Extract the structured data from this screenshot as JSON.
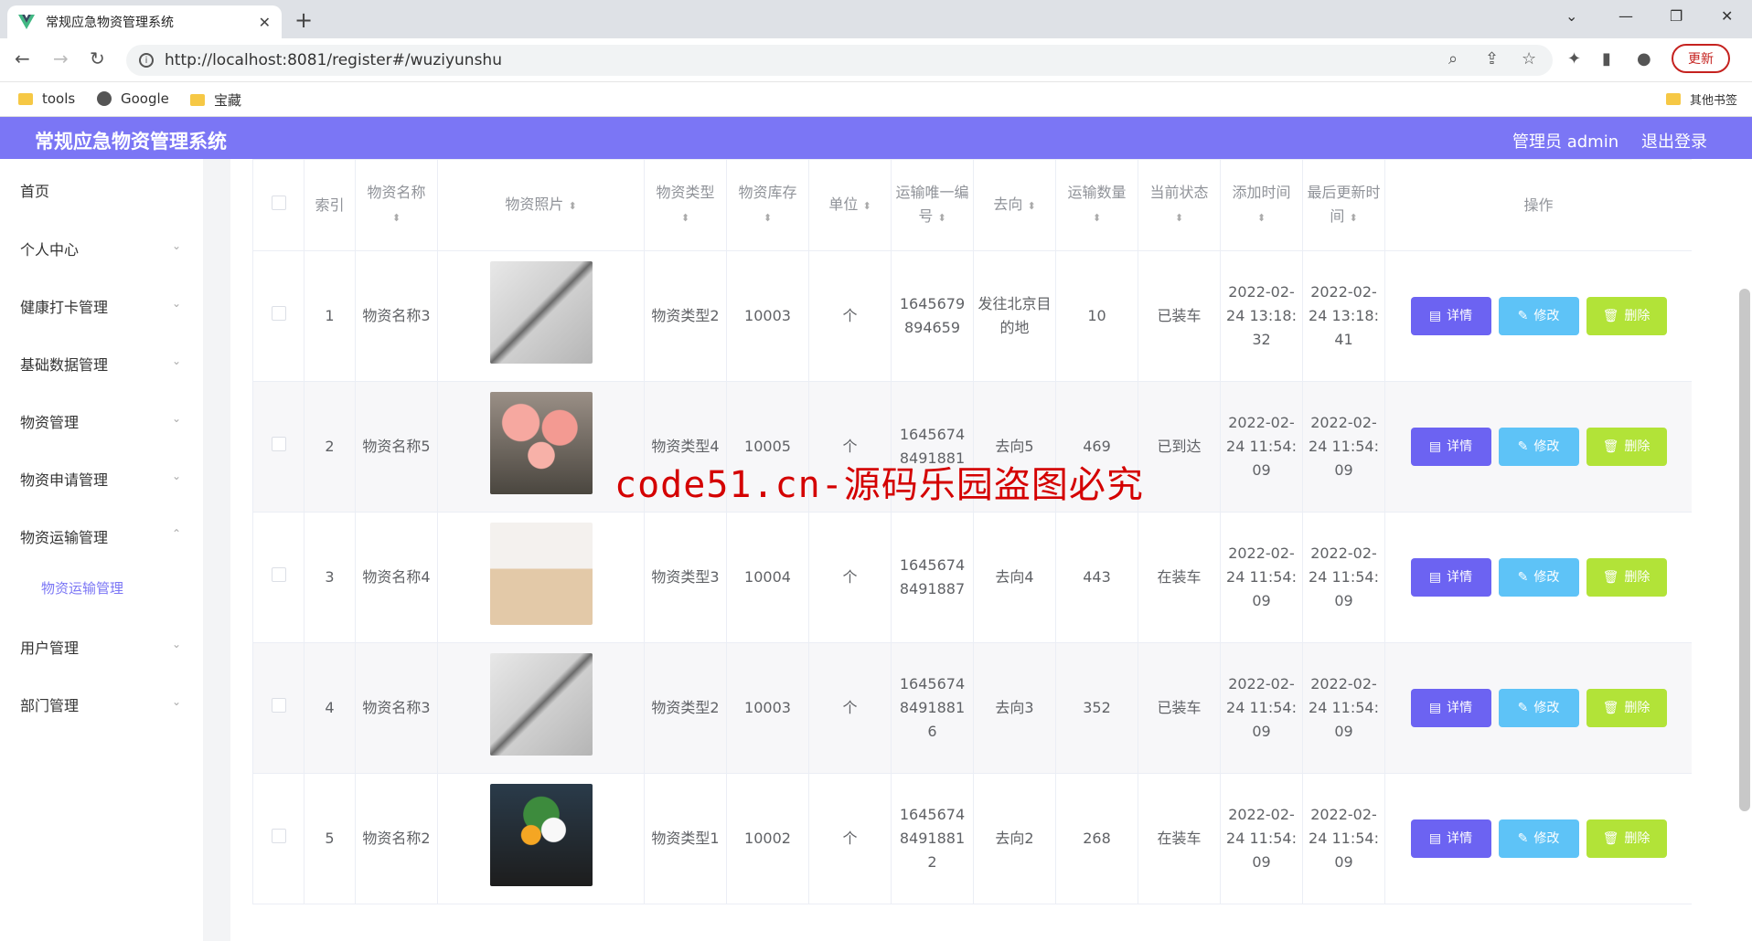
{
  "browser": {
    "tab_title": "常规应急物资管理系统",
    "url": "http://localhost:8081/register#/wuziyunshu",
    "update_label": "更新",
    "bookmarks": [
      "tools",
      "Google",
      "宝藏"
    ],
    "other_bookmarks": "其他书签"
  },
  "header": {
    "title": "常规应急物资管理系统",
    "user": "管理员 admin",
    "logout": "退出登录"
  },
  "sidebar": {
    "items": [
      {
        "label": "首页"
      },
      {
        "label": "个人中心"
      },
      {
        "label": "健康打卡管理"
      },
      {
        "label": "基础数据管理"
      },
      {
        "label": "物资管理"
      },
      {
        "label": "物资申请管理"
      },
      {
        "label": "物资运输管理"
      },
      {
        "label": "用户管理"
      },
      {
        "label": "部门管理"
      }
    ],
    "sub_item": "物资运输管理"
  },
  "table": {
    "headers": [
      "索引",
      "物资名称",
      "物资照片",
      "物资类型",
      "物资库存",
      "单位",
      "运输唯一编号",
      "去向",
      "运输数量",
      "当前状态",
      "添加时间",
      "最后更新时间",
      "操作"
    ],
    "rows": [
      {
        "index": "1",
        "name": "物资名称3",
        "image": "tool-image",
        "type": "物资类型2",
        "stock": "10003",
        "unit": "个",
        "code": "1645679894659",
        "dest": "发往北京目的地",
        "qty": "10",
        "status": "已装车",
        "added": "2022-02-24 13:18:32",
        "updated": "2022-02-24 13:18:41"
      },
      {
        "index": "2",
        "name": "物资名称5",
        "image": "flower-image",
        "type": "物资类型4",
        "stock": "10005",
        "unit": "个",
        "code": "16456748491881",
        "dest": "去向5",
        "qty": "469",
        "status": "已到达",
        "added": "2022-02-24 11:54:09",
        "updated": "2022-02-24 11:54:09"
      },
      {
        "index": "3",
        "name": "物资名称4",
        "image": "knife-block-image",
        "type": "物资类型3",
        "stock": "10004",
        "unit": "个",
        "code": "16456748491887",
        "dest": "去向4",
        "qty": "443",
        "status": "在装车",
        "added": "2022-02-24 11:54:09",
        "updated": "2022-02-24 11:54:09"
      },
      {
        "index": "4",
        "name": "物资名称3",
        "image": "tool-image",
        "type": "物资类型2",
        "stock": "10003",
        "unit": "个",
        "code": "164567484918816",
        "dest": "去向3",
        "qty": "352",
        "status": "已装车",
        "added": "2022-02-24 11:54:09",
        "updated": "2022-02-24 11:54:09"
      },
      {
        "index": "5",
        "name": "物资名称2",
        "image": "bouquet-image",
        "type": "物资类型1",
        "stock": "10002",
        "unit": "个",
        "code": "164567484918812",
        "dest": "去向2",
        "qty": "268",
        "status": "在装车",
        "added": "2022-02-24 11:54:09",
        "updated": "2022-02-24 11:54:09"
      }
    ],
    "actions": {
      "detail": "详情",
      "edit": "修改",
      "delete": "删除"
    }
  },
  "watermark": "code51.cn-源码乐园盗图必究",
  "colors": {
    "accent": "#7b76f5",
    "detail": "#6c63f2",
    "edit": "#5ec3f7",
    "delete": "#b2e338"
  }
}
